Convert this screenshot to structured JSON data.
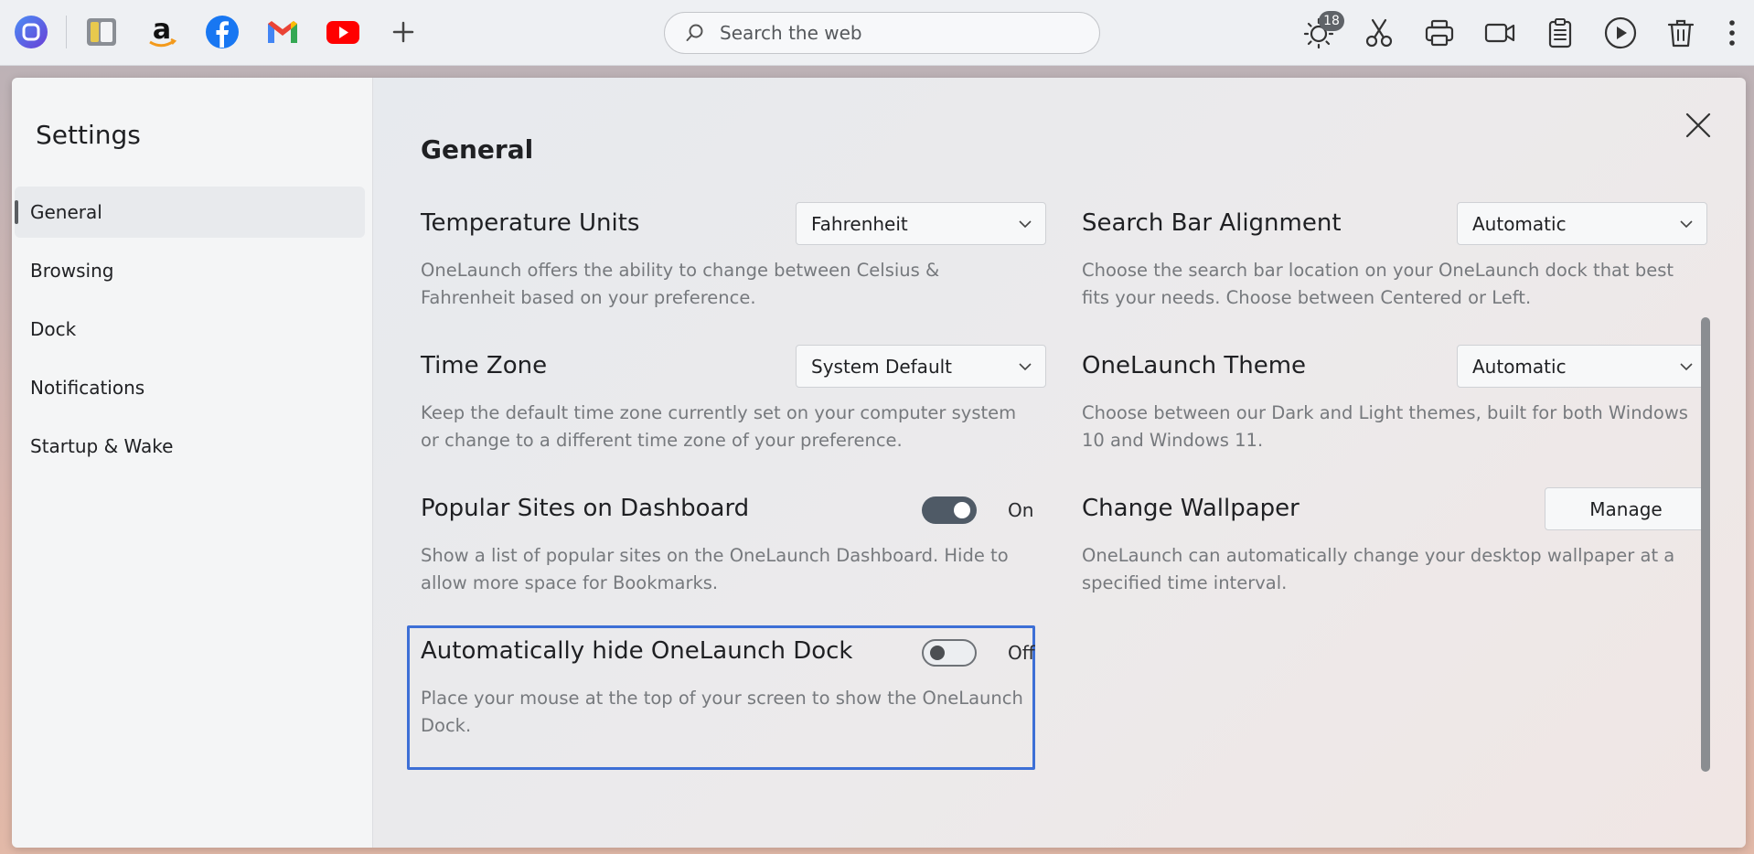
{
  "dock": {
    "apps": [
      {
        "name": "onelaunch-icon"
      },
      {
        "name": "window-manager-icon"
      },
      {
        "name": "amazon-icon"
      },
      {
        "name": "facebook-icon"
      },
      {
        "name": "gmail-icon"
      },
      {
        "name": "youtube-icon"
      },
      {
        "name": "add-icon"
      }
    ],
    "search": {
      "placeholder": "Search the web"
    },
    "weather_badge": "18",
    "tools": [
      "weather-icon",
      "scissors-icon",
      "printer-icon",
      "video-camera-icon",
      "clipboard-icon",
      "play-icon",
      "trash-icon",
      "more-icon"
    ]
  },
  "sidebar": {
    "title": "Settings",
    "items": [
      {
        "label": "General",
        "active": true
      },
      {
        "label": "Browsing"
      },
      {
        "label": "Dock"
      },
      {
        "label": "Notifications"
      },
      {
        "label": "Startup & Wake"
      }
    ]
  },
  "main": {
    "title": "General",
    "settings": {
      "temperature": {
        "title": "Temperature Units",
        "value": "Fahrenheit",
        "desc": "OneLaunch offers the ability to change between Celsius & Fahrenheit based on your preference."
      },
      "search_bar": {
        "title": "Search Bar Alignment",
        "value": "Automatic",
        "desc": "Choose the search bar location on your OneLaunch dock that best fits your needs. Choose between Centered or Left."
      },
      "time_zone": {
        "title": "Time Zone",
        "value": "System Default",
        "desc": "Keep the default time zone currently set on your computer system or change to a different time zone of your preference."
      },
      "theme": {
        "title": "OneLaunch Theme",
        "value": "Automatic",
        "desc": "Choose between our Dark and Light themes, built for both Windows 10 and Windows 11."
      },
      "popular_sites": {
        "title": "Popular Sites on Dashboard",
        "state": "On",
        "desc": "Show a list of popular sites on the OneLaunch Dashboard. Hide to allow more space for Bookmarks."
      },
      "wallpaper": {
        "title": "Change Wallpaper",
        "button": "Manage",
        "desc": "OneLaunch can automatically change your desktop wallpaper at a specified time interval."
      },
      "auto_hide": {
        "title": "Automatically hide OneLaunch Dock",
        "state": "Off",
        "desc": "Place your mouse at the top of your screen to show the OneLaunch Dock."
      }
    }
  },
  "colors": {
    "accent_focus": "#3d6fd6",
    "toggle_on": "#4f5a66"
  }
}
